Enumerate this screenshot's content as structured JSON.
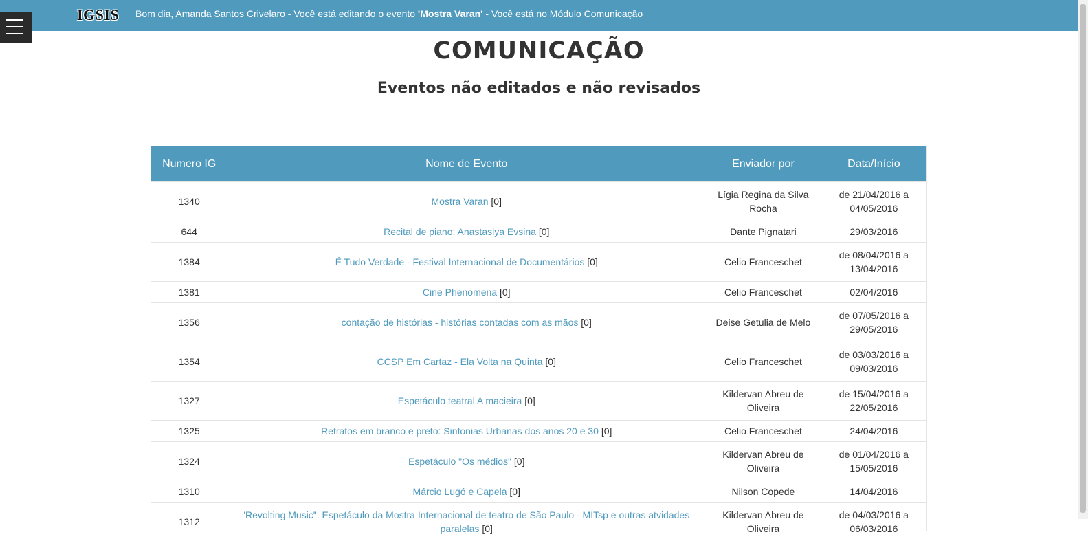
{
  "header": {
    "logo": "IGSIS",
    "greeting_prefix": "Bom dia, Amanda Santos Crivelaro - Você está editando o evento ",
    "event_name": "'Mostra Varan'",
    "greeting_suffix": " - Você está no Módulo Comunicação",
    "bar_color": "#4f9abd"
  },
  "menu": {
    "icon": "hamburger-menu-icon"
  },
  "page": {
    "title": "COMUNICAÇÃO",
    "subtitle": "Eventos não editados e não revisados"
  },
  "table": {
    "columns": [
      "Numero IG",
      "Nome de Evento",
      "Enviador por",
      "Data/Início"
    ],
    "rows": [
      {
        "ig": "1340",
        "name": "Mostra Varan",
        "count": "[0]",
        "sender": "Lígia Regina da Silva Rocha",
        "date": "de 21/04/2016 a 04/05/2016"
      },
      {
        "ig": "644",
        "name": "Recital de piano: Anastasiya Evsina",
        "count": "[0]",
        "sender": "Dante Pignatari",
        "date": "29/03/2016"
      },
      {
        "ig": "1384",
        "name": "É Tudo Verdade - Festival Internacional de Documentários",
        "count": "[0]",
        "sender": "Celio Franceschet",
        "date": "de 08/04/2016 a 13/04/2016"
      },
      {
        "ig": "1381",
        "name": "Cine Phenomena",
        "count": "[0]",
        "sender": "Celio Franceschet",
        "date": "02/04/2016"
      },
      {
        "ig": "1356",
        "name": "contação de histórias - histórias contadas com as mãos",
        "count": "[0]",
        "sender": "Deise Getulia de Melo",
        "date": "de 07/05/2016 a 29/05/2016"
      },
      {
        "ig": "1354",
        "name": "CCSP Em Cartaz - Ela Volta na Quinta",
        "count": "[0]",
        "sender": "Celio Franceschet",
        "date": "de 03/03/2016 a 09/03/2016"
      },
      {
        "ig": "1327",
        "name": "Espetáculo teatral A macieira",
        "count": "[0]",
        "sender": "Kildervan Abreu de Oliveira",
        "date": "de 15/04/2016 a 22/05/2016"
      },
      {
        "ig": "1325",
        "name": "Retratos em branco e preto: Sinfonias Urbanas dos anos 20 e 30",
        "count": "[0]",
        "sender": "Celio Franceschet",
        "date": "24/04/2016"
      },
      {
        "ig": "1324",
        "name": "Espetáculo \"Os médios\"",
        "count": "[0]",
        "sender": "Kildervan Abreu de Oliveira",
        "date": "de 01/04/2016 a 15/05/2016"
      },
      {
        "ig": "1310",
        "name": "Márcio Lugó e Capela",
        "count": "[0]",
        "sender": "Nilson Copede",
        "date": "14/04/2016"
      },
      {
        "ig": "1312",
        "name": "'Revolting Music\". Espetáculo da Mostra Internacional de teatro de São Paulo - MITsp e outras atvidades paralelas",
        "count": "[0]",
        "sender": "Kildervan Abreu de Oliveira",
        "date": "de 04/03/2016 a 06/03/2016"
      }
    ]
  }
}
